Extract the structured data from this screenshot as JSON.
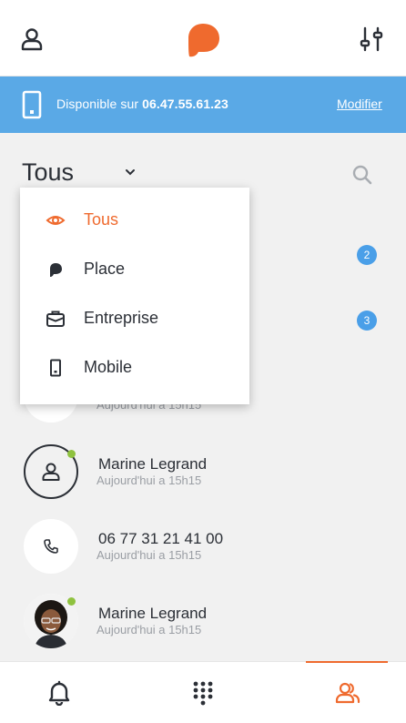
{
  "header": {
    "left_icon": "user-icon",
    "logo_icon": "app-logo",
    "right_icon": "settings-sliders-icon",
    "accent_color": "#ef6a2e"
  },
  "banner": {
    "prefix": "Disponible sur ",
    "number": "06.47.55.61.23",
    "modify_label": "Modifier",
    "icon": "mobile-phone-icon",
    "color": "#5aa9e6"
  },
  "filter": {
    "selected": "Tous",
    "search_icon": "search-icon"
  },
  "dropdown": {
    "items": [
      {
        "label": "Tous",
        "icon": "eye-icon",
        "active": true
      },
      {
        "label": "Place",
        "icon": "place-logo-icon",
        "active": false
      },
      {
        "label": "Entreprise",
        "icon": "briefcase-icon",
        "active": false
      },
      {
        "label": "Mobile",
        "icon": "mobile-icon",
        "active": false
      }
    ]
  },
  "list": {
    "badges": [
      "2",
      "3"
    ],
    "rows": [
      {
        "name": "",
        "time": "Aujourd'hui a 15h15"
      },
      {
        "name": "Marine Legrand",
        "time": "Aujourd'hui a 15h15",
        "avatar": "user-outline",
        "online": true
      },
      {
        "name": "06 77 31 21 41 00",
        "time": "Aujourd'hui a 15h15",
        "avatar": "phone"
      },
      {
        "name": "Marine Legrand",
        "time": "Aujourd'hui a 15h15",
        "avatar": "photo",
        "online": true
      }
    ]
  },
  "bottom_nav": {
    "tabs": [
      {
        "icon": "bell-icon"
      },
      {
        "icon": "dialpad-icon"
      },
      {
        "icon": "contacts-icon",
        "active": true
      }
    ]
  }
}
